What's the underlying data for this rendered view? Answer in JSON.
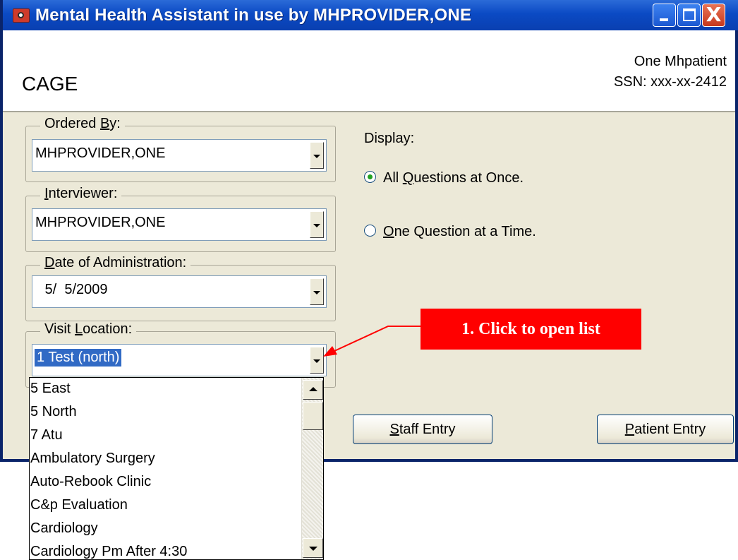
{
  "window": {
    "title": "Mental Health Assistant in use by MHPROVIDER,ONE",
    "icon": "mha-app-icon",
    "controls": {
      "minimize": "minimize-icon",
      "maximize": "maximize-icon",
      "close": "close-icon",
      "close_glyph": "X"
    }
  },
  "header": {
    "form_title": "CAGE",
    "patient_name": "One Mhpatient",
    "patient_ssn": "SSN: xxx-xx-2412"
  },
  "fields": {
    "ordered_by": {
      "label_pre": "Ordered ",
      "label_key": "B",
      "label_post": "y:",
      "value": "MHPROVIDER,ONE"
    },
    "interviewer": {
      "label_pre": "",
      "label_key": "I",
      "label_post": "nterviewer:",
      "value": "MHPROVIDER,ONE"
    },
    "date": {
      "label_pre": "",
      "label_key": "D",
      "label_post": "ate of Administration:",
      "value": " 5/  5/2009"
    },
    "visit_location": {
      "label_pre": "Visit ",
      "label_key": "L",
      "label_post": "ocation:",
      "value": "1 Test (north)"
    }
  },
  "display": {
    "label": "Display:",
    "options": [
      {
        "pre": "All ",
        "key": "Q",
        "post": "uestions at Once.",
        "checked": true
      },
      {
        "pre": "",
        "key": "O",
        "post": "ne Question at a Time.",
        "checked": false
      }
    ]
  },
  "buttons": {
    "staff": {
      "key": "S",
      "post": "taff Entry"
    },
    "patient": {
      "key": "P",
      "post": "atient Entry"
    }
  },
  "callout": {
    "text": "1. Click to open list",
    "color": "#ff0000"
  },
  "location_list": {
    "items": [
      "5 East",
      "5 North",
      "7 Atu",
      "Ambulatory Surgery",
      "Auto-Rebook Clinic",
      "C&p Evaluation",
      "Cardiology",
      "Cardiology Pm After 4:30"
    ]
  },
  "colors": {
    "titlebar": "#0b4ac4",
    "window_bg": "#ece9d8",
    "selection": "#316ac5",
    "accent_red": "#ff0000"
  }
}
